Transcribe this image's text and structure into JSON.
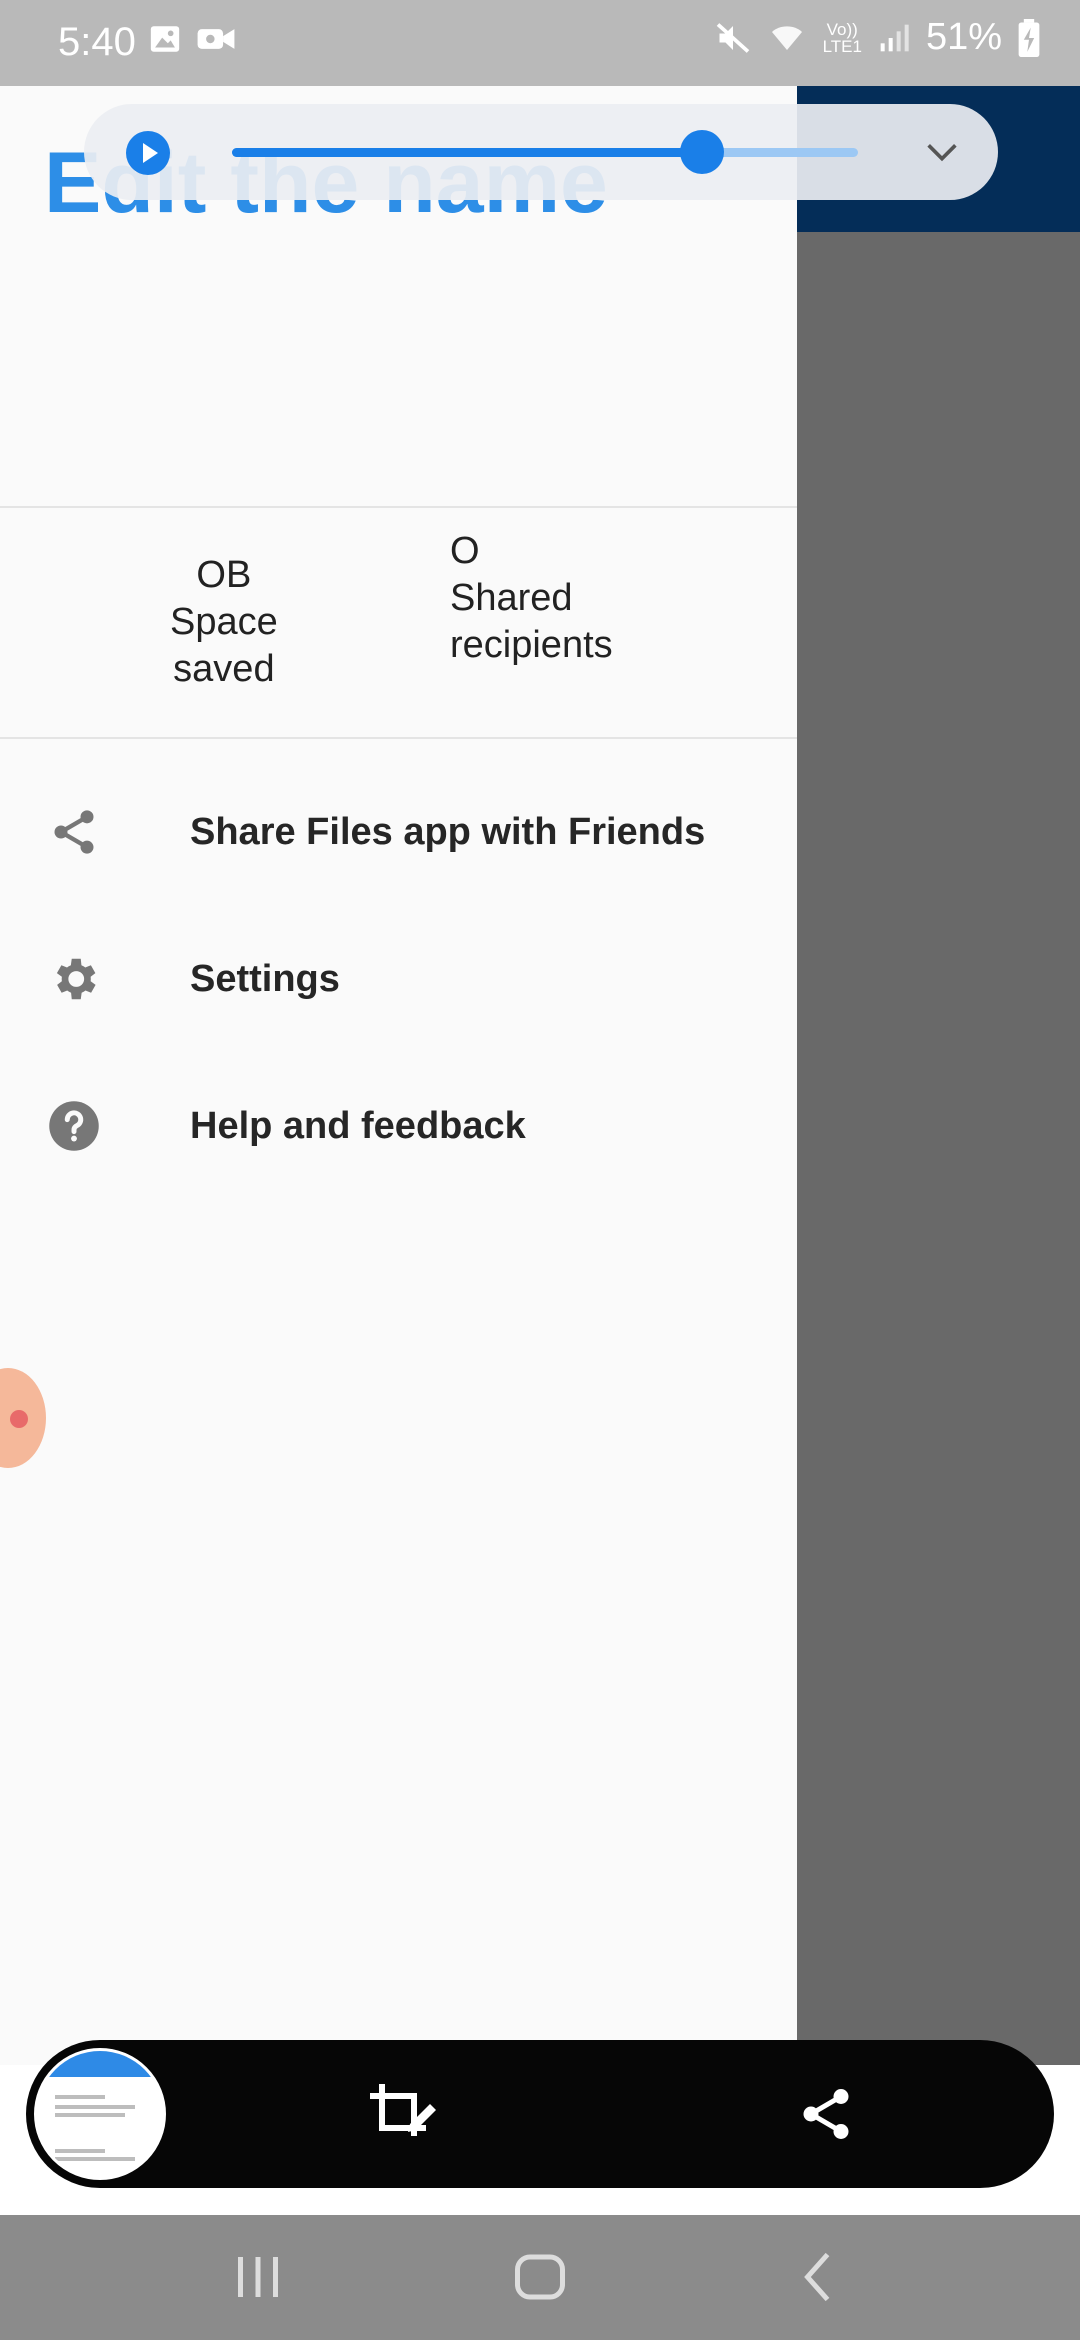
{
  "status_bar": {
    "time": "5:40",
    "battery": "51%",
    "network": "LTE1"
  },
  "media_control": {
    "progress_fraction": 0.75
  },
  "drawer": {
    "header_title": "Edit the name",
    "stats": {
      "space_saved_value": "OB",
      "space_saved_label_line1": "Space",
      "space_saved_label_line2": "saved",
      "shared_value": "O",
      "shared_label_line1": "Shared",
      "shared_label_line2": "recipients"
    },
    "menu": [
      {
        "label": "Share Files app with Friends",
        "icon": "share-icon"
      },
      {
        "label": "Settings",
        "icon": "gear-icon"
      },
      {
        "label": "Help and feedback",
        "icon": "help-icon"
      }
    ]
  },
  "colors": {
    "accent": "#1a7fe8",
    "appbar": "#0a64c4",
    "drawer_bg": "#fafafa",
    "icon_gray": "#777777"
  }
}
